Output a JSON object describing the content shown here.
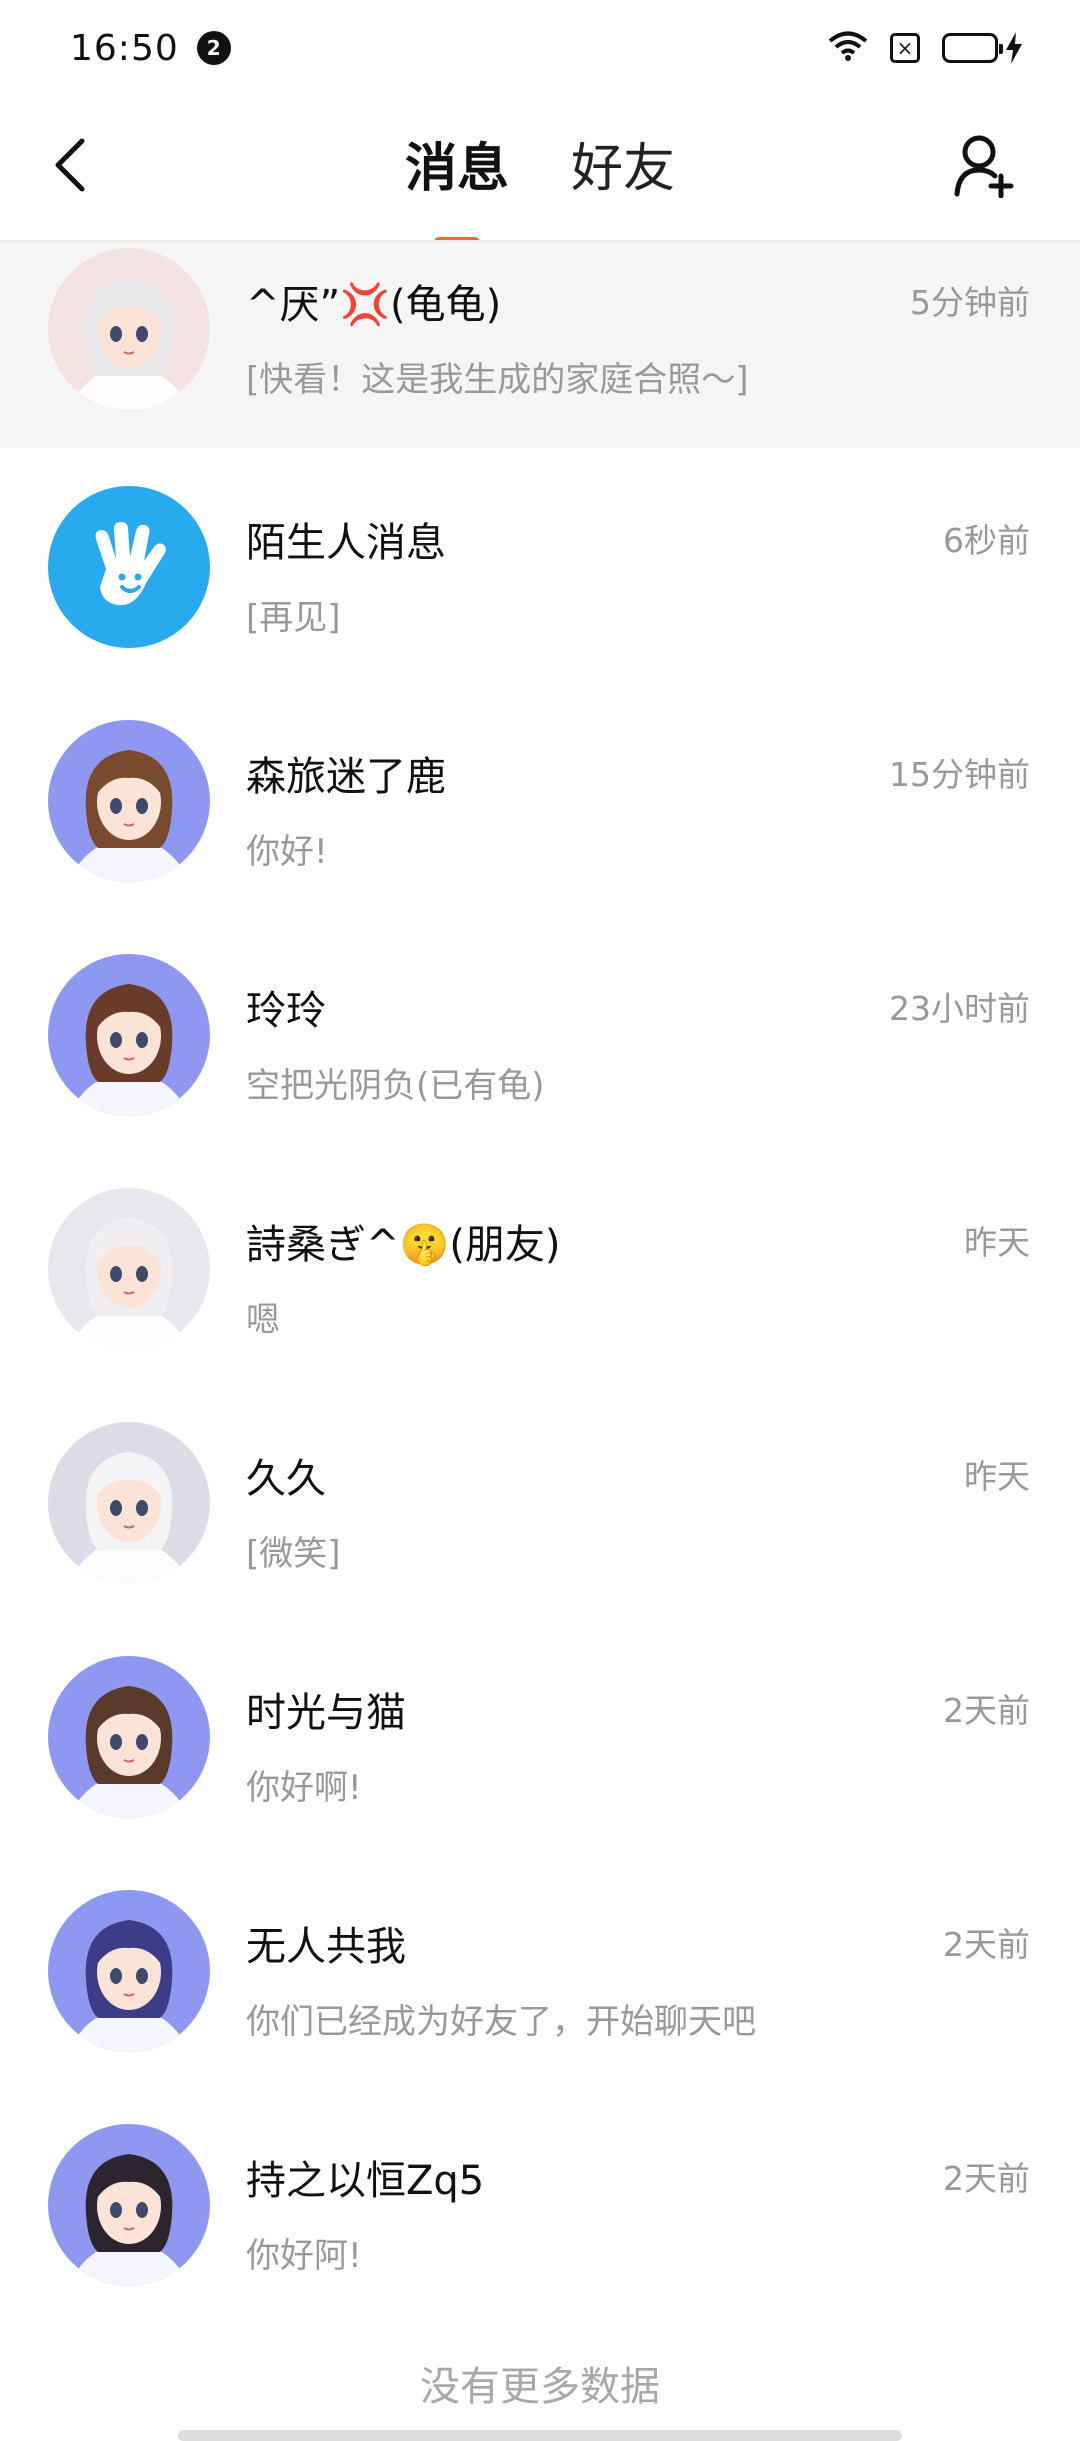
{
  "status_bar": {
    "time": "16:50",
    "notification_count": "2",
    "sim_glyph": "×"
  },
  "header": {
    "tabs": [
      {
        "label": "消息",
        "active": true
      },
      {
        "label": "好友",
        "active": false
      }
    ],
    "accent_color": "#ff6a13",
    "icons": {
      "back": "chevron-left-icon",
      "add_friend": "add-user-icon"
    }
  },
  "conversations": [
    {
      "name": "^厌”💢(龟龟)",
      "preview": "[快看！这是我生成的家庭合照～]",
      "time": "5分钟前",
      "avatar": "anime-girl-white-hair-scarf",
      "avatar_bg": "#f4e2e2",
      "hair": "#e8e8ea",
      "highlight": true
    },
    {
      "name": "陌生人消息",
      "preview": "[再见]",
      "time": "6秒前",
      "avatar": "stranger-hand-icon",
      "avatar_bg": "#2aaaee",
      "hair": "",
      "highlight": false
    },
    {
      "name": "森旅迷了鹿",
      "preview": "你好!",
      "time": "15分钟前",
      "avatar": "anime-girl-brown-hair",
      "avatar_bg": "#8e98f0",
      "hair": "#7a4a2e",
      "highlight": false
    },
    {
      "name": "玲玲",
      "preview": "空把光阴负(已有龟)",
      "time": "23小时前",
      "avatar": "anime-girl-maid",
      "avatar_bg": "#8e98f0",
      "hair": "#6b3b2a",
      "highlight": false
    },
    {
      "name": "詩桑ぎ^🤫(朋友)",
      "preview": "嗯",
      "time": "昨天",
      "avatar": "anime-girl-silver-eyepatch",
      "avatar_bg": "#e9e7ee",
      "hair": "#f1eef2",
      "highlight": false
    },
    {
      "name": "久久",
      "preview": "[微笑]",
      "time": "昨天",
      "avatar": "anime-girl-white-hair-salute",
      "avatar_bg": "#dddbe6",
      "hair": "#f4f4f6",
      "highlight": false
    },
    {
      "name": "时光与猫",
      "preview": "你好啊!",
      "time": "2天前",
      "avatar": "anime-girl-short-brown-hair",
      "avatar_bg": "#8e98f0",
      "hair": "#5a3a2a",
      "highlight": false
    },
    {
      "name": "无人共我",
      "preview": "你们已经成为好友了，开始聊天吧",
      "time": "2天前",
      "avatar": "anime-boy-purple-hair",
      "avatar_bg": "#8e98f0",
      "hair": "#3c3d86",
      "highlight": false
    },
    {
      "name": "持之以恒Zq5",
      "preview": "你好阿!",
      "time": "2天前",
      "avatar": "anime-girl-dark-hair-ears",
      "avatar_bg": "#8e98f0",
      "hair": "#2c2530",
      "highlight": false
    }
  ],
  "footer": {
    "no_more_text": "没有更多数据"
  }
}
